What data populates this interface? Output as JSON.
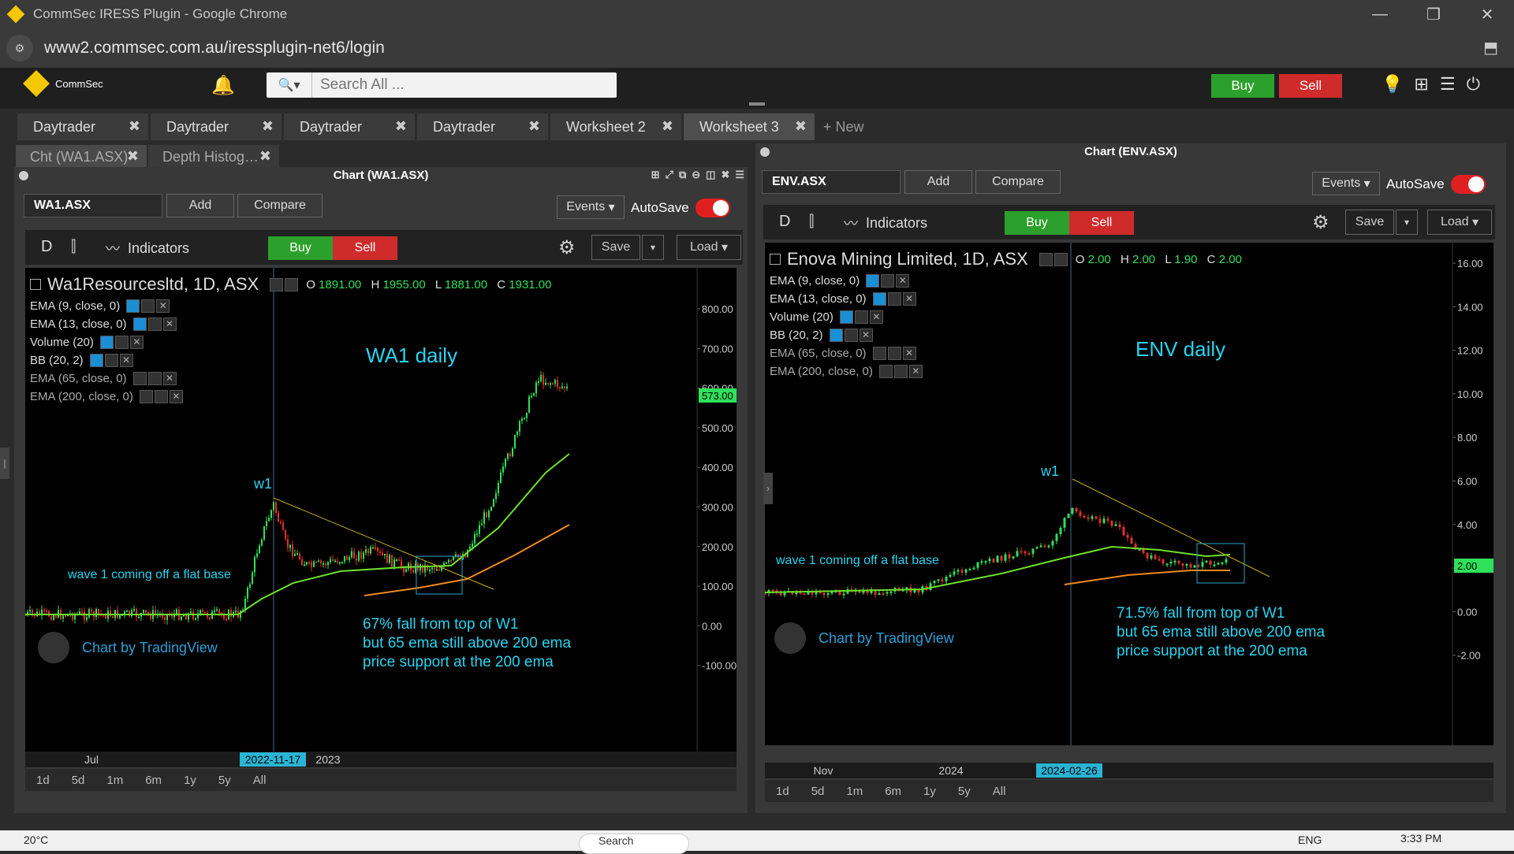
{
  "browser": {
    "title": "CommSec IRESS Plugin - Google Chrome",
    "url": "www2.commsec.com.au/iressplugin-net6/login"
  },
  "app": {
    "brand": "CommSec",
    "search_placeholder": "Search All ...",
    "buy_label": "Buy",
    "sell_label": "Sell"
  },
  "tabs": [
    {
      "label": "Daytrader"
    },
    {
      "label": "Daytrader"
    },
    {
      "label": "Daytrader"
    },
    {
      "label": "Daytrader"
    },
    {
      "label": "Worksheet 2"
    },
    {
      "label": "Worksheet 3"
    }
  ],
  "new_tab_label": "+ New",
  "subtabs": [
    {
      "label": "Cht (WA1.ASX)"
    },
    {
      "label": "Depth Histog…"
    }
  ],
  "left_chart": {
    "panel_title": "Chart (WA1.ASX)",
    "symbol": "WA1.ASX",
    "add_label": "Add",
    "compare_label": "Compare",
    "events_label": "Events",
    "autosave_label": "AutoSave",
    "interval": "D",
    "indicators_label": "Indicators",
    "buy_label": "Buy",
    "sell_label": "Sell",
    "save_label": "Save",
    "load_label": "Load",
    "legend_title": "Wa1Resourcesltd, 1D, ASX",
    "o_label": "O",
    "o": "1891.00",
    "h_label": "H",
    "h": "1955.00",
    "l_label": "L",
    "l": "1881.00",
    "c_label": "C",
    "c": "1931.00",
    "indicators": [
      {
        "label": "EMA (9, close, 0)",
        "visible": true
      },
      {
        "label": "EMA (13, close, 0)",
        "visible": true
      },
      {
        "label": "Volume (20)",
        "visible": true
      },
      {
        "label": "BB (20, 2)",
        "visible": true
      },
      {
        "label": "EMA (65, close, 0)",
        "visible": false
      },
      {
        "label": "EMA (200, close, 0)",
        "visible": false
      }
    ],
    "annotation_title": "WA1 daily",
    "wave_label": "w1",
    "base_note": "wave 1 coming off a flat base",
    "notes": [
      "67% fall from top of W1",
      "but 65 ema still above 200 ema",
      "price support at the 200 ema"
    ],
    "watermark": "Chart by TradingView",
    "price_labels": [
      "800.00",
      "700.00",
      "600.00",
      "500.00",
      "400.00",
      "300.00",
      "200.00",
      "100.00",
      "0.00",
      "-100.00"
    ],
    "last_price": "573.00",
    "time_labels": [
      "Jul",
      "2022-11-17",
      "2023"
    ],
    "ranges": [
      "1d",
      "5d",
      "1m",
      "6m",
      "1y",
      "5y",
      "All"
    ]
  },
  "right_chart": {
    "panel_title": "Chart (ENV.ASX)",
    "symbol": "ENV.ASX",
    "add_label": "Add",
    "compare_label": "Compare",
    "events_label": "Events",
    "autosave_label": "AutoSave",
    "interval": "D",
    "indicators_label": "Indicators",
    "buy_label": "Buy",
    "sell_label": "Sell",
    "save_label": "Save",
    "load_label": "Load",
    "legend_title": "Enova Mining Limited, 1D, ASX",
    "o_label": "O",
    "o": "2.00",
    "h_label": "H",
    "h": "2.00",
    "l_label": "L",
    "l": "1.90",
    "c_label": "C",
    "c": "2.00",
    "indicators": [
      {
        "label": "EMA (9, close, 0)",
        "visible": true
      },
      {
        "label": "EMA (13, close, 0)",
        "visible": true
      },
      {
        "label": "Volume (20)",
        "visible": true
      },
      {
        "label": "BB (20, 2)",
        "visible": true
      },
      {
        "label": "EMA (65, close, 0)",
        "visible": false
      },
      {
        "label": "EMA (200, close, 0)",
        "visible": false
      }
    ],
    "annotation_title": "ENV daily",
    "wave_label": "w1",
    "base_note": "wave 1 coming off a flat base",
    "notes": [
      "71.5% fall from top of W1",
      "but 65 ema still above 200 ema",
      "price support at the 200 ema"
    ],
    "watermark": "Chart by TradingView",
    "price_labels": [
      "16.00",
      "14.00",
      "12.00",
      "10.00",
      "8.00",
      "6.00",
      "4.00",
      "2.00",
      "0.00",
      "-2.00"
    ],
    "last_price": "2.00",
    "time_labels": [
      "Nov",
      "2024",
      "2024-02-26"
    ],
    "ranges": [
      "1d",
      "5d",
      "1m",
      "6m",
      "1y",
      "5y",
      "All"
    ]
  },
  "taskbar": {
    "weather": "20°C",
    "search": "Search",
    "lang": "ENG",
    "time": "3:33 PM"
  }
}
